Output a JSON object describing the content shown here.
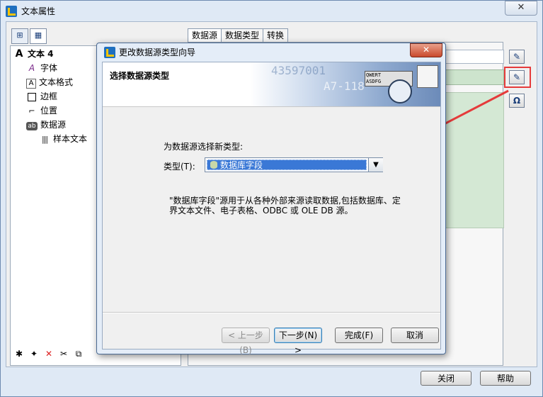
{
  "outer_window": {
    "title": "文本属性",
    "close_symbol": "✕"
  },
  "tree": {
    "root": "文本 4",
    "items": [
      {
        "label": "字体",
        "icon": "font-icon"
      },
      {
        "label": "文本格式",
        "icon": "text-format-icon"
      },
      {
        "label": "边框",
        "icon": "border-icon"
      },
      {
        "label": "位置",
        "icon": "position-icon"
      },
      {
        "label": "数据源",
        "icon": "datasource-icon"
      }
    ],
    "child": "样本文本"
  },
  "tabs": [
    {
      "label": "数据源"
    },
    {
      "label": "数据类型"
    },
    {
      "label": "转换"
    }
  ],
  "footer": {
    "close_label": "关闭",
    "help_label": "帮助"
  },
  "wizard": {
    "title": "更改数据源类型向导",
    "close_symbol": "✕",
    "heading": "选择数据源类型",
    "banner_code1": "43597001",
    "banner_code2": "A7-118",
    "banner_keys": "QWERT ASDFG",
    "prompt": "为数据源选择新类型:",
    "type_label": "类型(T):",
    "selected_type": "数据库字段",
    "description": "\"数据库字段\"源用于从各种外部来源读取数据,包括数据库、定界文本文件、电子表格、ODBC 或 OLE DB 源。",
    "buttons": {
      "back": "< 上一步(B)",
      "next": "下一步(N) >",
      "finish": "完成(F)",
      "cancel": "取消"
    }
  },
  "colors": {
    "highlight_red": "#e53b3b",
    "selection_blue": "#3a78d6",
    "green_field": "#cde4cd"
  }
}
